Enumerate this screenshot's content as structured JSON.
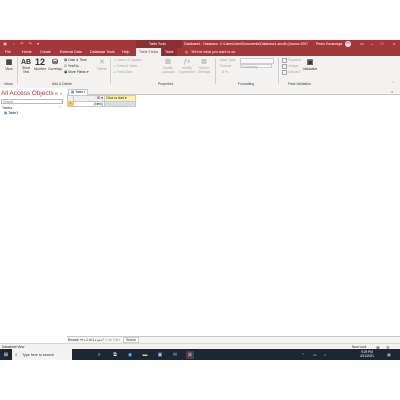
{
  "window": {
    "title": "Table Tools",
    "document_title": "Database1 : Database- C:\\Users\\User\\Documents\\Database1.accdb (Access 2007 - 2016 file format) - Access",
    "user": "Pedro Escarcega",
    "user_initials": "PE"
  },
  "tabs": [
    {
      "label": "File"
    },
    {
      "label": "Home"
    },
    {
      "label": "Create"
    },
    {
      "label": "External Data"
    },
    {
      "label": "Database Tools"
    },
    {
      "label": "Help"
    },
    {
      "label": "Table Fields"
    },
    {
      "label": "Table"
    }
  ],
  "tell_me": "Tell me what you want to do",
  "ribbon": {
    "views": {
      "view_label": "View",
      "group_label": "Views"
    },
    "add_delete": {
      "short_text": "Short Text",
      "number_glyph": "12",
      "number": "Number",
      "currency": "Currency",
      "date_time": "Date & Time",
      "yes_no": "Yes/No",
      "more_fields": "More Fields",
      "delete": "Delete",
      "group_label": "Add & Delete"
    },
    "properties": {
      "name_caption": "Name & Caption",
      "default_value": "Default Value",
      "field_size": "Field Size",
      "modify_lookups": "Modify Lookups",
      "modify_expression": "Modify Expression",
      "memo_settings": "Memo Settings",
      "group_label": "Properties"
    },
    "formatting": {
      "data_type": "Data Type:",
      "format": "Format:",
      "format_value": "Formatting",
      "symbols": "$  %  ,",
      "group_label": "Formatting"
    },
    "field_validation": {
      "required": "Required",
      "unique": "Unique",
      "indexed": "Indexed",
      "validation": "Validation",
      "group_label": "Field Validation"
    }
  },
  "nav_pane": {
    "header": "All Access Objects",
    "search_placeholder": "Search...",
    "section": "Tables",
    "items": [
      {
        "label": "Table1"
      }
    ]
  },
  "document": {
    "tab_label": "Table1",
    "columns": [
      "ID",
      "Click to Add"
    ],
    "new_row_marker": "*",
    "new_row_id": "(New)"
  },
  "record_nav": {
    "label": "Record:",
    "position": "1 of 1",
    "filter": "No Filter",
    "search": "Search"
  },
  "statusbar": {
    "left": "Datasheet View",
    "right": "Num Lock"
  },
  "taskbar": {
    "search_placeholder": "Type here to search",
    "time": "9:29 PM",
    "date": "4/11/2021"
  },
  "colors": {
    "access_red": "#a4373a",
    "taskbar": "#1d2733"
  }
}
